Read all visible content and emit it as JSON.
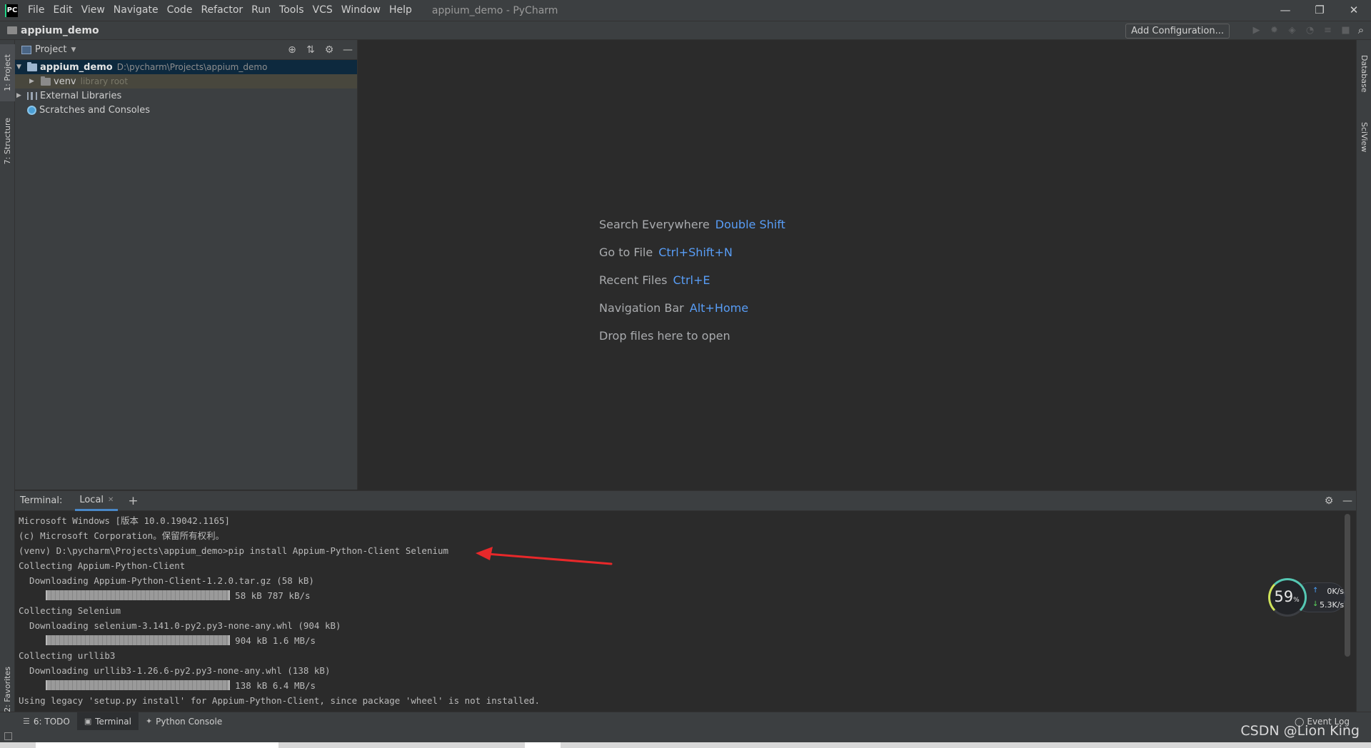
{
  "window": {
    "logo": "PC",
    "title": "appium_demo - PyCharm",
    "menu": [
      "File",
      "Edit",
      "View",
      "Navigate",
      "Code",
      "Refactor",
      "Run",
      "Tools",
      "VCS",
      "Window",
      "Help"
    ],
    "controls": [
      "—",
      "❐",
      "✕"
    ]
  },
  "navbar": {
    "project": "appium_demo",
    "add_configuration": "Add Configuration..."
  },
  "left_strip": {
    "project_tab": "1: Project",
    "structure_tab": "7: Structure",
    "favorites_tab": "2: Favorites"
  },
  "right_strip": {
    "database_tab": "Database",
    "sciview_tab": "SciView"
  },
  "project_panel": {
    "header": "Project",
    "tree": [
      {
        "name": "appium_demo",
        "path": "D:\\pycharm\\Projects\\appium_demo"
      },
      {
        "name": "venv",
        "hint": "library root"
      },
      {
        "name": "External Libraries"
      },
      {
        "name": "Scratches and Consoles"
      }
    ]
  },
  "editor": {
    "hints": [
      {
        "label": "Search Everywhere",
        "shortcut": "Double Shift"
      },
      {
        "label": "Go to File",
        "shortcut": "Ctrl+Shift+N"
      },
      {
        "label": "Recent Files",
        "shortcut": "Ctrl+E"
      },
      {
        "label": "Navigation Bar",
        "shortcut": "Alt+Home"
      },
      {
        "label": "Drop files here to open",
        "shortcut": ""
      }
    ]
  },
  "terminal": {
    "title": "Terminal:",
    "tab": "Local",
    "lines": [
      "Microsoft Windows [版本 10.0.19042.1165]",
      "(c) Microsoft Corporation。保留所有权利。",
      "(venv) D:\\pycharm\\Projects\\appium_demo>pip install Appium-Python-Client Selenium",
      "Collecting Appium-Python-Client",
      "  Downloading Appium-Python-Client-1.2.0.tar.gz (58 kB)",
      " 58 kB 787 kB/s",
      "Collecting Selenium",
      "  Downloading selenium-3.141.0-py2.py3-none-any.whl (904 kB)",
      " 904 kB 1.6 MB/s",
      "Collecting urllib3",
      "  Downloading urllib3-1.26.6-py2.py3-none-any.whl (138 kB)",
      " 138 kB 6.4 MB/s",
      "Using legacy 'setup.py install' for Appium-Python-Client, since package 'wheel' is not installed."
    ]
  },
  "net_widget": {
    "cpu": "59",
    "cpu_unit": "%",
    "up": "0K/s",
    "down": "5.3K/s"
  },
  "bottom_bar": {
    "todo": "6: TODO",
    "terminal": "Terminal",
    "python_console": "Python Console",
    "event_log": "Event Log"
  },
  "watermark": "CSDN @Lion King",
  "colors": {
    "accent": "#589df6",
    "arrow": "#e8282a",
    "background": "#2b2b2b",
    "panel": "#3c3f41"
  }
}
